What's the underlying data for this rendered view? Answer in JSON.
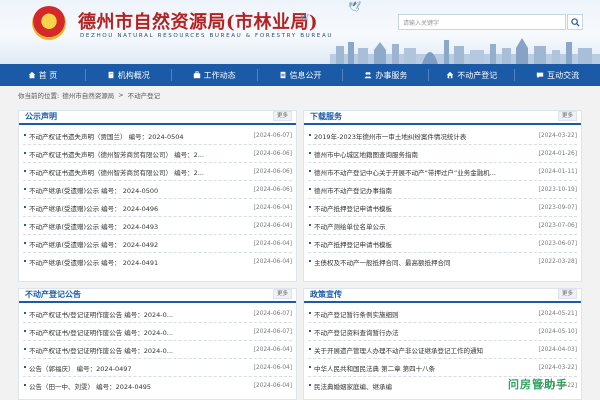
{
  "header": {
    "title": "德州市自然资源局(市林业局)",
    "subtitle": "DEZHOU NATURAL RESOURCES BUREAU & FORESTRY BUREAU",
    "search_placeholder": "请输入关键字"
  },
  "nav": [
    {
      "label": "首  页",
      "icon": "home-icon"
    },
    {
      "label": "机构概况",
      "icon": "building-icon"
    },
    {
      "label": "工作动态",
      "icon": "briefcase-icon"
    },
    {
      "label": "信息公开",
      "icon": "document-icon"
    },
    {
      "label": "办事服务",
      "icon": "people-icon"
    },
    {
      "label": "不动产登记",
      "icon": "house-icon"
    },
    {
      "label": "互动交流",
      "icon": "chat-icon"
    }
  ],
  "breadcrumb": {
    "prefix": "你当前的位置:",
    "home": "德州市自然资源局",
    "current": "不动产登记",
    "sep": ">"
  },
  "panels": {
    "announce": {
      "title": "公示声明",
      "more": "更多",
      "items": [
        {
          "text": "不动产权证书遗失声明（贾国兰） 编号：2024-0504",
          "date": "[2024-06-07]"
        },
        {
          "text": "不动产权证书遗失声明（德州智芳商贸有限公司） 编号：2...",
          "date": "[2024-06-06]"
        },
        {
          "text": "不动产权证书遗失声明（德州智芳商贸有限公司） 编号：2...",
          "date": "[2024-06-06]"
        },
        {
          "text": "不动产继承(受遗赠)公示 编号： 2024-0500",
          "date": "[2024-06-06]"
        },
        {
          "text": "不动产继承(受遗赠)公示 编号： 2024-0496",
          "date": "[2024-06-04]"
        },
        {
          "text": "不动产继承(受遗赠)公示 编号： 2024-0493",
          "date": "[2024-06-04]"
        },
        {
          "text": "不动产继承(受遗赠)公示 编号： 2024-0492",
          "date": "[2024-06-04]"
        },
        {
          "text": "不动产继承(受遗赠)公示 编号： 2024-0491",
          "date": "[2024-06-04]"
        }
      ]
    },
    "download": {
      "title": "下载服务",
      "more": "更多",
      "items": [
        {
          "text": "2019年-2023年德州市一审土地纠纷案件情况统计表",
          "date": "[2024-03-22]"
        },
        {
          "text": "德州市中心城区地籍图查询服务指南",
          "date": "[2024-01-26]"
        },
        {
          "text": "德州市不动产登记中心关于开展不动产“带押过户”业务金融机...",
          "date": "[2024-01-11]"
        },
        {
          "text": "德州市不动产登记办事指南",
          "date": "[2023-10-19]"
        },
        {
          "text": "不动产抵押登记申请书模板",
          "date": "[2023-09-07]"
        },
        {
          "text": "不动产测绘单位名单公示",
          "date": "[2023-07-06]"
        },
        {
          "text": "不动产抵押登记申请书模板",
          "date": "[2023-06-07]"
        },
        {
          "text": "主债权及不动产一般抵押合同、最高额抵押合同",
          "date": "[2022-03-28]"
        }
      ]
    },
    "registration": {
      "title": "不动产登记公告",
      "more": "更多",
      "items": [
        {
          "text": "不动产权证书/登记证明作废公告 编号：2024-0...",
          "date": "[2024-06-07]"
        },
        {
          "text": "不动产权证书/登记证明作废公告 编号：2024-0...",
          "date": "[2024-06-07]"
        },
        {
          "text": "不动产权证书/登记证明作废公告 编号：2024-0...",
          "date": "[2024-06-04]"
        },
        {
          "text": "公告（郭福庆） 编号：2024-0497",
          "date": "[2024-06-04]"
        },
        {
          "text": "公告（田一中、刘雯） 编号：2024-0495",
          "date": "[2024-06-04]"
        }
      ]
    },
    "policy": {
      "title": "政策宣传",
      "more": "更多",
      "items": [
        {
          "text": "不动产登记暂行条例实施细则",
          "date": "[2024-05-21]"
        },
        {
          "text": "不动产登记资料查询暂行办法",
          "date": "[2024-05-10]"
        },
        {
          "text": "关于开展遗产管理人办理不动产非公证继承登记工作的通知",
          "date": "[2024-04-03]"
        },
        {
          "text": "中华人民共和国民法典 第二章 第四十八条",
          "date": "[2024-03-22]"
        },
        {
          "text": "民法典婚姻家庭编、继承编",
          "date": "[2024-03-22]"
        }
      ]
    }
  },
  "watermark": "问房管助手",
  "colors": {
    "primary": "#1a5aa6",
    "title_red": "#b22222",
    "watermark_green": "#1a9a50"
  }
}
